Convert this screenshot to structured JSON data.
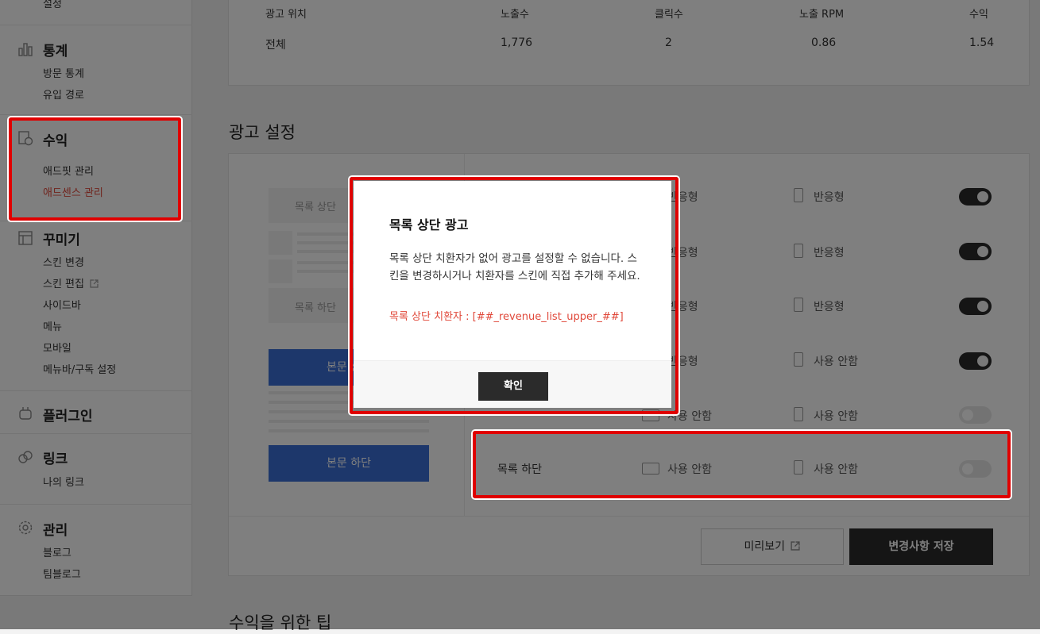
{
  "sidebar": {
    "cut_top_label": "설정",
    "stats": {
      "title": "통계",
      "items": [
        "방문 통계",
        "유입 경로"
      ]
    },
    "revenue": {
      "title": "수익",
      "items": [
        "애드핏 관리",
        "애드센스 관리"
      ],
      "active_item": "애드센스 관리",
      "active_color": "#e0483a"
    },
    "decorate": {
      "title": "꾸미기",
      "items": [
        "스킨 변경",
        "스킨 편집",
        "사이드바",
        "메뉴",
        "모바일",
        "메뉴바/구독 설정"
      ]
    },
    "plugin": {
      "title": "플러그인"
    },
    "link": {
      "title": "링크",
      "items": [
        "나의 링크"
      ]
    },
    "manage": {
      "title": "관리",
      "items": [
        "블로그",
        "팀블로그"
      ]
    }
  },
  "stats_table": {
    "headers": [
      "광고 위치",
      "노출수",
      "클릭수",
      "노출 RPM",
      "수익"
    ],
    "rows": [
      [
        "전체",
        "1,776",
        "2",
        "0.86",
        "1.54"
      ]
    ]
  },
  "ad_settings": {
    "title": "광고 설정",
    "preview": {
      "list_top": "목록 상단",
      "list_bottom": "목록 하단",
      "body_top": "본문 상단",
      "body_bottom": "본문 하단"
    },
    "rows": [
      {
        "label": "",
        "pc": "반응형",
        "mobile": "반응형",
        "enabled": true
      },
      {
        "label": "",
        "pc": "반응형",
        "mobile": "반응형",
        "enabled": true
      },
      {
        "label": "",
        "pc": "반응형",
        "mobile": "반응형",
        "enabled": true
      },
      {
        "label": "",
        "pc": "반응형",
        "mobile": "사용 안함",
        "enabled": true
      },
      {
        "label": "",
        "pc": "사용 안함",
        "mobile": "사용 안함",
        "enabled": false
      },
      {
        "label": "목록 하단",
        "pc": "사용 안함",
        "mobile": "사용 안함",
        "enabled": false
      }
    ],
    "preview_button": "미리보기",
    "save_button": "변경사항 저장"
  },
  "tips_title": "수익을 위한 팁",
  "modal": {
    "title": "목록 상단 광고",
    "message": "목록 상단 치환자가 없어 광고를 설정할 수 없습니다. 스킨을 변경하시거나 치환자를 스킨에 직접 추가해 주세요.",
    "replacer_note": "목록 상단 치환자 : [##_revenue_list_upper_##]",
    "ok_button": "확인"
  },
  "colors": {
    "highlight": "#e00000",
    "accent_blue": "#3b6fd6",
    "dark_button": "#2b2b2b"
  }
}
